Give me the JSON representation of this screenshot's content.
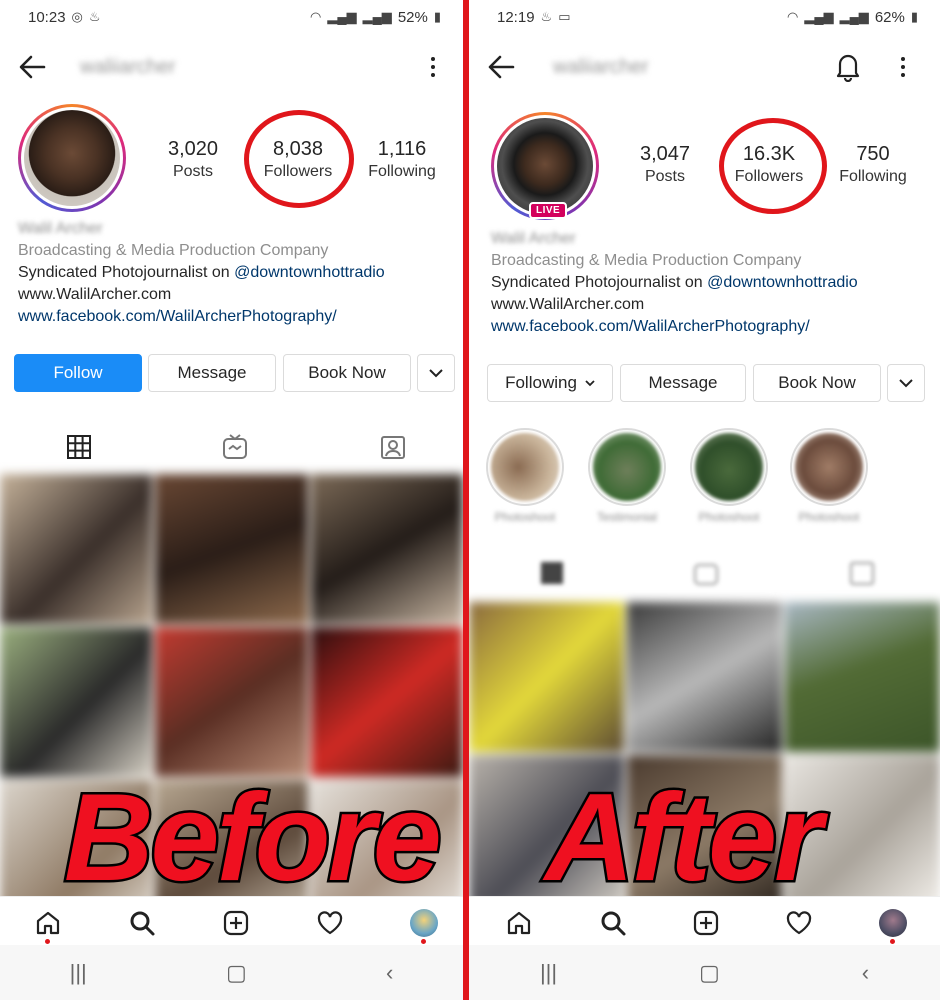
{
  "before": {
    "status": {
      "time": "10:23",
      "battery": "52%"
    },
    "username": "waliiarcher",
    "stats": [
      {
        "num": "3,020",
        "label": "Posts"
      },
      {
        "num": "8,038",
        "label": "Followers"
      },
      {
        "num": "1,116",
        "label": "Following"
      }
    ],
    "bio": {
      "name": "Walil Archer",
      "category": "Broadcasting & Media Production Company",
      "desc_prefix": "Syndicated Photojournalist on ",
      "desc_handle": "@downtownhottradio",
      "website": "www.WalilArcher.com",
      "link": "www.facebook.com/WalilArcherPhotography/"
    },
    "buttons": {
      "follow": "Follow",
      "message": "Message",
      "book": "Book Now"
    },
    "overlay": "Before"
  },
  "after": {
    "status": {
      "time": "12:19",
      "battery": "62%"
    },
    "username": "waliiarcher",
    "live": "LIVE",
    "stats": [
      {
        "num": "3,047",
        "label": "Posts"
      },
      {
        "num": "16.3K",
        "label": "Followers"
      },
      {
        "num": "750",
        "label": "Following"
      }
    ],
    "bio": {
      "name": "Walil Archer",
      "category": "Broadcasting & Media Production Company",
      "desc_prefix": "Syndicated Photojournalist on ",
      "desc_handle": "@downtownhottradio",
      "website": "www.WalilArcher.com",
      "link": "www.facebook.com/WalilArcherPhotography/"
    },
    "buttons": {
      "following": "Following",
      "message": "Message",
      "book": "Book Now"
    },
    "highlights": [
      "Photoshoot",
      "Testimonial",
      "Photoshoot",
      "Photoshoot"
    ],
    "overlay": "After"
  },
  "colors": {
    "follow_blue": "#1a8cf7",
    "annotation_red": "#e0161b",
    "link_blue": "#00376b"
  }
}
